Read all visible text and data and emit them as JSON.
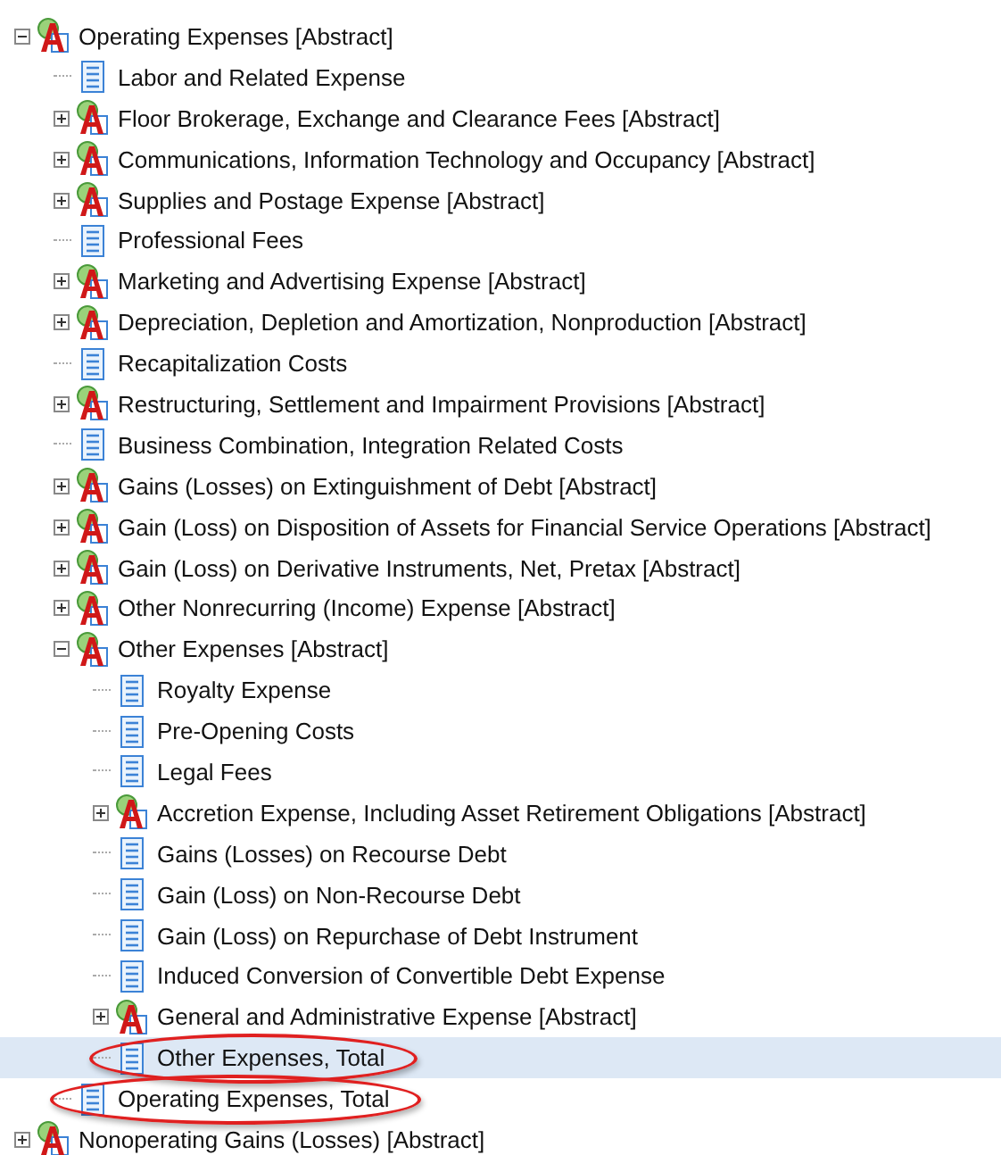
{
  "tree": [
    {
      "kind": "abstract",
      "label": "Operating Expenses [Abstract]",
      "expanded": true,
      "selected": false,
      "circled": false,
      "children": [
        {
          "kind": "item",
          "label": "Labor and Related Expense",
          "selected": false,
          "circled": false
        },
        {
          "kind": "abstract",
          "label": "Floor Brokerage, Exchange and Clearance Fees [Abstract]",
          "expanded": false,
          "selected": false,
          "circled": false
        },
        {
          "kind": "abstract",
          "label": "Communications, Information Technology and Occupancy [Abstract]",
          "expanded": false,
          "selected": false,
          "circled": false
        },
        {
          "kind": "abstract",
          "label": "Supplies and Postage Expense [Abstract]",
          "expanded": false,
          "selected": false,
          "circled": false
        },
        {
          "kind": "item",
          "label": "Professional Fees",
          "selected": false,
          "circled": false
        },
        {
          "kind": "abstract",
          "label": "Marketing and Advertising Expense [Abstract]",
          "expanded": false,
          "selected": false,
          "circled": false
        },
        {
          "kind": "abstract",
          "label": "Depreciation, Depletion and Amortization, Nonproduction [Abstract]",
          "expanded": false,
          "selected": false,
          "circled": false
        },
        {
          "kind": "item",
          "label": "Recapitalization Costs",
          "selected": false,
          "circled": false
        },
        {
          "kind": "abstract",
          "label": "Restructuring, Settlement and Impairment Provisions [Abstract]",
          "expanded": false,
          "selected": false,
          "circled": false
        },
        {
          "kind": "item",
          "label": "Business Combination, Integration Related Costs",
          "selected": false,
          "circled": false
        },
        {
          "kind": "abstract",
          "label": "Gains (Losses) on Extinguishment of Debt [Abstract]",
          "expanded": false,
          "selected": false,
          "circled": false
        },
        {
          "kind": "abstract",
          "label": "Gain (Loss) on Disposition of Assets for Financial Service Operations [Abstract]",
          "expanded": false,
          "selected": false,
          "circled": false
        },
        {
          "kind": "abstract",
          "label": "Gain (Loss) on Derivative Instruments, Net, Pretax [Abstract]",
          "expanded": false,
          "selected": false,
          "circled": false
        },
        {
          "kind": "abstract",
          "label": "Other Nonrecurring (Income) Expense [Abstract]",
          "expanded": false,
          "selected": false,
          "circled": false
        },
        {
          "kind": "abstract",
          "label": "Other Expenses [Abstract]",
          "expanded": true,
          "selected": false,
          "circled": false,
          "children": [
            {
              "kind": "item",
              "label": "Royalty Expense",
              "selected": false,
              "circled": false
            },
            {
              "kind": "item",
              "label": "Pre-Opening Costs",
              "selected": false,
              "circled": false
            },
            {
              "kind": "item",
              "label": "Legal Fees",
              "selected": false,
              "circled": false
            },
            {
              "kind": "abstract",
              "label": "Accretion Expense, Including Asset Retirement Obligations [Abstract]",
              "expanded": false,
              "selected": false,
              "circled": false
            },
            {
              "kind": "item",
              "label": "Gains (Losses) on Recourse Debt",
              "selected": false,
              "circled": false
            },
            {
              "kind": "item",
              "label": "Gain (Loss) on Non-Recourse Debt",
              "selected": false,
              "circled": false
            },
            {
              "kind": "item",
              "label": "Gain (Loss) on Repurchase of Debt Instrument",
              "selected": false,
              "circled": false
            },
            {
              "kind": "item",
              "label": "Induced Conversion of Convertible Debt Expense",
              "selected": false,
              "circled": false
            },
            {
              "kind": "abstract",
              "label": "General and Administrative Expense [Abstract]",
              "expanded": false,
              "selected": false,
              "circled": false
            },
            {
              "kind": "item",
              "label": "Other Expenses, Total",
              "selected": true,
              "circled": true
            }
          ]
        },
        {
          "kind": "item",
          "label": "Operating Expenses, Total",
          "selected": false,
          "circled": true
        }
      ]
    },
    {
      "kind": "abstract",
      "label": "Nonoperating Gains (Losses) [Abstract]",
      "expanded": false,
      "selected": false,
      "circled": false
    }
  ]
}
